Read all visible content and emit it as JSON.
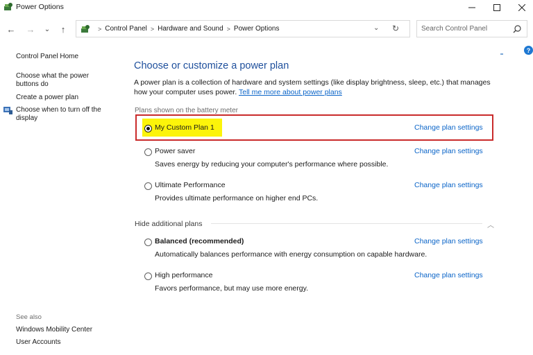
{
  "window": {
    "title": "Power Options",
    "icon": "power-options-icon"
  },
  "nav": {
    "back": "←",
    "forward": "→",
    "recent": "⌄",
    "up": "↑"
  },
  "address": {
    "crumbs": [
      "Control Panel",
      "Hardware and Sound",
      "Power Options"
    ],
    "separator": ">"
  },
  "search": {
    "placeholder": "Search Control Panel"
  },
  "sidebar": {
    "home": "Control Panel Home",
    "items": [
      "Choose what the power buttons do",
      "Create a power plan",
      "Choose when to turn off the display"
    ],
    "see_also_label": "See also",
    "see_also": [
      "Windows Mobility Center",
      "User Accounts"
    ]
  },
  "main": {
    "heading": "Choose or customize a power plan",
    "description": "A power plan is a collection of hardware and system settings (like display brightness, sleep, etc.) that manages how your computer uses power.",
    "learn_more": "Tell me more about power plans",
    "battery_group_label": "Plans shown on the battery meter",
    "plans": [
      {
        "name": "My Custom Plan 1",
        "desc": "",
        "selected": true,
        "bold": false
      },
      {
        "name": "Power saver",
        "desc": "Saves energy by reducing your computer's performance where possible.",
        "selected": false,
        "bold": false
      },
      {
        "name": "Ultimate Performance",
        "desc": "Provides ultimate performance on higher end PCs.",
        "selected": false,
        "bold": false
      }
    ],
    "hide_label": "Hide additional plans",
    "additional_plans": [
      {
        "name": "Balanced (recommended)",
        "desc": "Automatically balances performance with energy consumption on capable hardware.",
        "selected": false,
        "bold": true
      },
      {
        "name": "High performance",
        "desc": "Favors performance, but may use more energy.",
        "selected": false,
        "bold": false
      }
    ],
    "change_label": "Change plan settings"
  },
  "colors": {
    "accent": "#0a64c8",
    "heading": "#1e4f9c",
    "highlight_border": "#c92a2a",
    "highlight_fill": "#fcf40a"
  }
}
